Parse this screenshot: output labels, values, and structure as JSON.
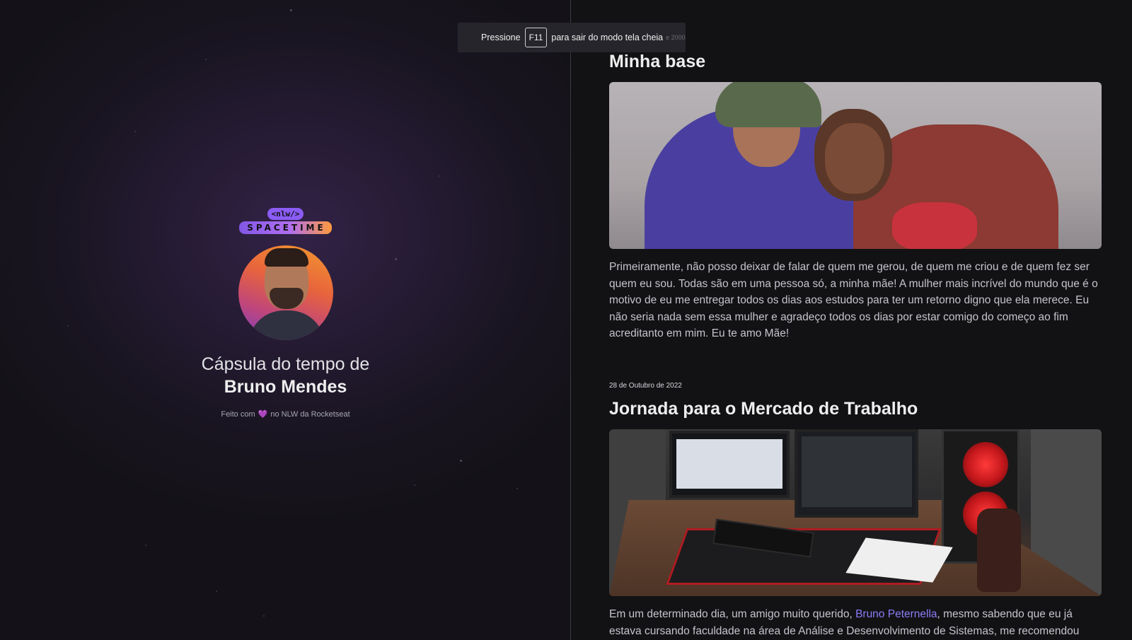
{
  "profile": {
    "logo_tag": "<nlw/>",
    "logo_word": "SPACETIME",
    "title_line": "Cápsula do tempo de",
    "name": "Bruno Mendes",
    "made_prefix": "Feito com",
    "made_suffix": "no NLW da Rocketseat"
  },
  "fullscreen_toast": {
    "prefix": "Pressione",
    "key": "F11",
    "suffix": "para sair do modo tela cheia",
    "ghost": "e 2000"
  },
  "memories": [
    {
      "title": "Minha base",
      "image_alt": "Foto de Bruno com sua mãe",
      "text": "Primeiramente, não posso deixar de falar de quem me gerou, de quem me criou e de quem fez ser quem eu sou. Todas são em uma pessoa só, a minha mãe! A mulher mais incrível do mundo que é o motivo de eu me entregar todos os dias aos estudos para ter um retorno digno que ela merece. Eu não seria nada sem essa mulher e agradeço todos os dias por estar comigo do começo ao fim acreditanto em mim. Eu te amo Mãe!"
    },
    {
      "date": "28 de Outubro de 2022",
      "title": "Jornada para o Mercado de Trabalho",
      "image_alt": "Setup com computador e monitores",
      "text_before": "Em um determinado dia, um amigo muito querido, ",
      "link": "Bruno Peternella",
      "text_after": ", mesmo sabendo que eu já estava cursando faculdade na área de Análise e Desenvolvimento de Sistemas, me recomendou"
    }
  ],
  "colors": {
    "accent": "#8b5cf6",
    "link": "#8b7cf6",
    "background": "#121215"
  }
}
